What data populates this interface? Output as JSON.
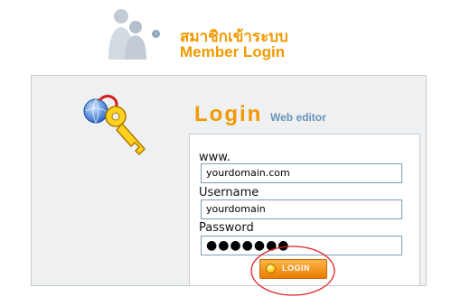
{
  "header": {
    "title_th": "สมาชิกเข้าระบบ",
    "title_en": "Member Login"
  },
  "login": {
    "heading": "Login",
    "subheading": "Web editor"
  },
  "form": {
    "domain_label": "www.",
    "domain_value": "yourdomain.com",
    "username_label": "Username",
    "username_value": "yourdomain",
    "password_label": "Password",
    "password_value": "●●●●●●●"
  },
  "button": {
    "login_label": "LOGIN"
  },
  "colors": {
    "accent": "#f29900",
    "subheading": "#6a94b8",
    "highlight": "#e02020"
  }
}
